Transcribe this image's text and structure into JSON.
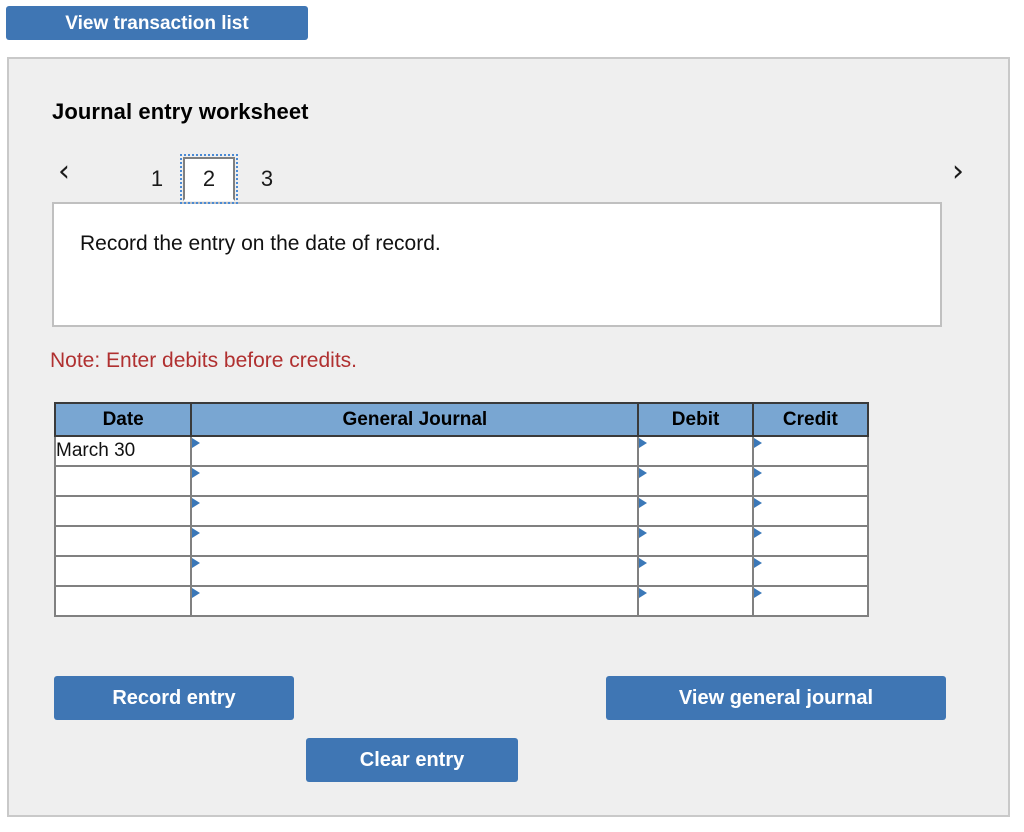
{
  "top_bar": {
    "view_transaction_list_label": "View transaction list"
  },
  "worksheet": {
    "title": "Journal entry worksheet",
    "tabs": {
      "prev_icon": "‹",
      "next_icon": "›",
      "items": [
        {
          "label": "1",
          "selected": false
        },
        {
          "label": "2",
          "selected": true
        },
        {
          "label": "3",
          "selected": false
        }
      ],
      "active_tab": "2"
    },
    "instruction": "Record the entry on the date of record.",
    "note": "Note: Enter debits before credits."
  },
  "journal_table": {
    "columns": [
      "Date",
      "General Journal",
      "Debit",
      "Credit"
    ],
    "rows": [
      {
        "date": "March 30",
        "general_journal": "",
        "debit": "",
        "credit": ""
      },
      {
        "date": "",
        "general_journal": "",
        "debit": "",
        "credit": ""
      },
      {
        "date": "",
        "general_journal": "",
        "debit": "",
        "credit": ""
      },
      {
        "date": "",
        "general_journal": "",
        "debit": "",
        "credit": ""
      },
      {
        "date": "",
        "general_journal": "",
        "debit": "",
        "credit": ""
      },
      {
        "date": "",
        "general_journal": "",
        "debit": "",
        "credit": ""
      }
    ]
  },
  "actions": {
    "record_entry_label": "Record entry",
    "clear_entry_label": "Clear entry",
    "view_general_journal_label": "View general journal"
  },
  "colors": {
    "button_blue": "#3f76b4",
    "table_header_blue": "#79a6d2",
    "note_red": "#b03030",
    "panel_background": "#efefef",
    "marker_blue": "#3b78b8"
  }
}
